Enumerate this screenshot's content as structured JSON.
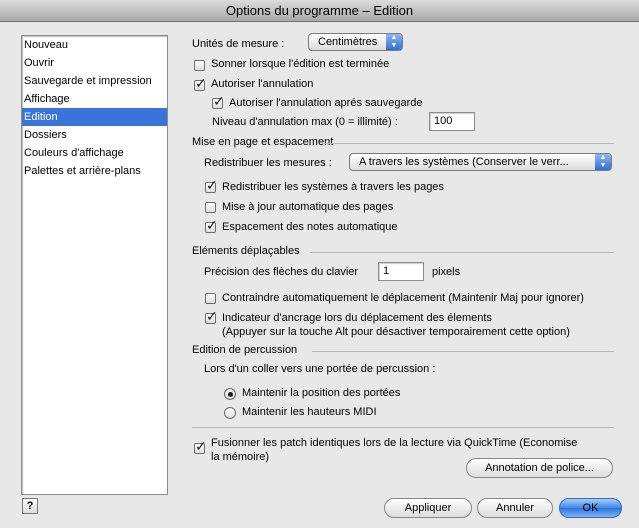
{
  "window": {
    "title": "Options du programme – Edition"
  },
  "sidebar": {
    "items": [
      {
        "label": "Nouveau"
      },
      {
        "label": "Ouvrir"
      },
      {
        "label": "Sauvegarde et impression"
      },
      {
        "label": "Affichage"
      },
      {
        "label": "Edition",
        "selected": true
      },
      {
        "label": "Dossiers"
      },
      {
        "label": "Couleurs d'affichage"
      },
      {
        "label": "Palettes et arrière-plans"
      }
    ]
  },
  "units": {
    "label": "Unités de mesure :",
    "value": "Centimètres"
  },
  "options": {
    "sound_label": "Sonner lorsque l'édition est terminée",
    "sound_checked": false,
    "undo_label": "Autoriser l'annulation",
    "undo_checked": true,
    "undo_after_save_label": "Autoriser l'annulation aprés sauvegarde",
    "undo_after_save_checked": true,
    "undo_level_label": "Niveau d'annulation max (0 = illimité) :",
    "undo_level_value": "100"
  },
  "layout_section": {
    "title": "Mise en page et espacement",
    "rebar_label": "Redistribuer les mesures :",
    "rebar_value": "A travers les systèmes (Conserver le verr...",
    "reflow_systems_label": "Redistribuer les systèmes à travers les pages",
    "reflow_systems_checked": true,
    "auto_update_label": "Mise à jour automatique des pages",
    "auto_update_checked": false,
    "auto_spacing_label": "Espacement des notes automatique",
    "auto_spacing_checked": true
  },
  "movable_section": {
    "title": "Eléments déplaçables",
    "arrow_precision_label": "Précision des flèches du clavier",
    "arrow_precision_value": "1",
    "arrow_precision_unit": "pixels",
    "constrain_label": "Contraindre automatiquement le déplacement (Maintenir Maj pour ignorer)",
    "constrain_checked": false,
    "anchor_label_line1": "Indicateur d'ancrage lors du déplacement des élements",
    "anchor_label_line2": "(Appuyer sur la touche Alt pour désactiver temporairement cette option)",
    "anchor_checked": true
  },
  "percussion_section": {
    "title": "Edition de percussion",
    "paste_label": "Lors d'un coller vers une portée de percussion :",
    "keep_staff_label": "Maintenir la position des portées",
    "keep_staff_selected": true,
    "keep_midi_label": "Maintenir les hauteurs MIDI",
    "keep_midi_selected": false
  },
  "quicktime": {
    "label_line1": "Fusionner les patch identiques lors de la lecture via QuickTime (Economise",
    "label_line2": "la mémoire)",
    "checked": true
  },
  "buttons": {
    "font_annotation": "Annotation de police...",
    "apply": "Appliquer",
    "cancel": "Annuler",
    "ok": "OK",
    "help": "?"
  },
  "colors": {
    "selection": "#3875d7",
    "default_button": "#2f74dc"
  }
}
